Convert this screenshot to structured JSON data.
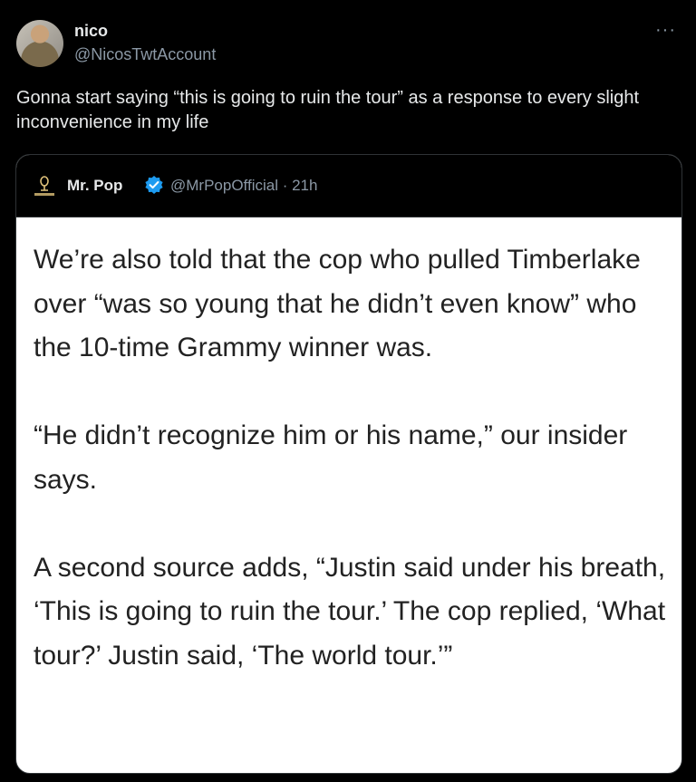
{
  "author": {
    "display_name": "nico",
    "handle": "@NicosTwtAccount"
  },
  "more_label": "···",
  "tweet_text": "Gonna start saying “this is going to ruin the tour” as a response to every slight inconvenience in my life",
  "quoted": {
    "name": "Mr. Pop",
    "handle_time": "@MrPopOfficial · 21h",
    "verified_color": "#1d9bf0",
    "paragraphs": [
      "We’re also told that the cop who pulled Timberlake over “was so young that he didn’t even know” who the 10-time Grammy winner was.",
      "“He didn’t recognize him or his name,” our insider says.",
      "A second source adds, “Justin said under his breath, ‘This is going to ruin the tour.’ The cop replied, ‘What tour?’ Justin said, ‘The world tour.’”"
    ]
  },
  "colors": {
    "background": "#000000",
    "text": "#e7e9ea",
    "muted": "#8b98a5",
    "quote_body_bg": "#ffffff",
    "quote_body_text": "#222222"
  }
}
